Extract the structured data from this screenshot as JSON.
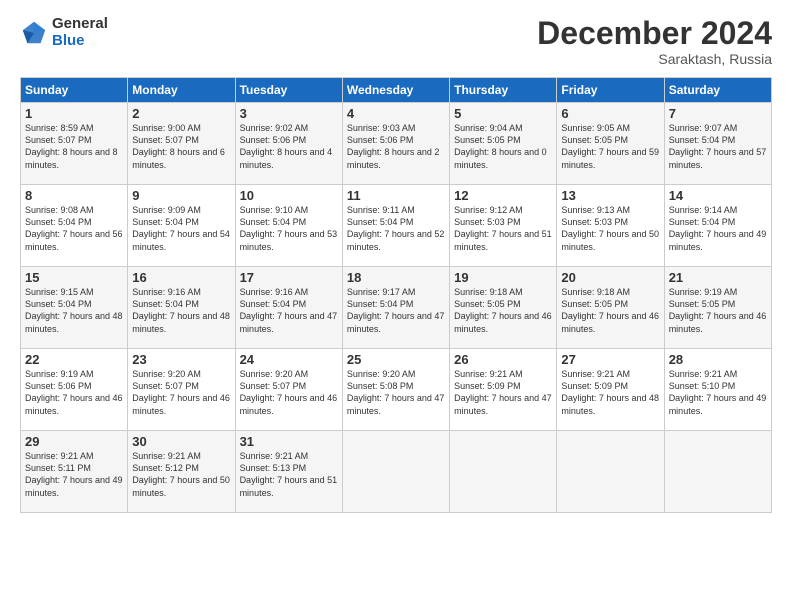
{
  "logo": {
    "general": "General",
    "blue": "Blue"
  },
  "header": {
    "month": "December 2024",
    "location": "Saraktash, Russia"
  },
  "weekdays": [
    "Sunday",
    "Monday",
    "Tuesday",
    "Wednesday",
    "Thursday",
    "Friday",
    "Saturday"
  ],
  "weeks": [
    [
      {
        "day": "1",
        "sunrise": "8:59 AM",
        "sunset": "5:07 PM",
        "daylight": "8 hours and 8 minutes."
      },
      {
        "day": "2",
        "sunrise": "9:00 AM",
        "sunset": "5:07 PM",
        "daylight": "8 hours and 6 minutes."
      },
      {
        "day": "3",
        "sunrise": "9:02 AM",
        "sunset": "5:06 PM",
        "daylight": "8 hours and 4 minutes."
      },
      {
        "day": "4",
        "sunrise": "9:03 AM",
        "sunset": "5:06 PM",
        "daylight": "8 hours and 2 minutes."
      },
      {
        "day": "5",
        "sunrise": "9:04 AM",
        "sunset": "5:05 PM",
        "daylight": "8 hours and 0 minutes."
      },
      {
        "day": "6",
        "sunrise": "9:05 AM",
        "sunset": "5:05 PM",
        "daylight": "7 hours and 59 minutes."
      },
      {
        "day": "7",
        "sunrise": "9:07 AM",
        "sunset": "5:04 PM",
        "daylight": "7 hours and 57 minutes."
      }
    ],
    [
      {
        "day": "8",
        "sunrise": "9:08 AM",
        "sunset": "5:04 PM",
        "daylight": "7 hours and 56 minutes."
      },
      {
        "day": "9",
        "sunrise": "9:09 AM",
        "sunset": "5:04 PM",
        "daylight": "7 hours and 54 minutes."
      },
      {
        "day": "10",
        "sunrise": "9:10 AM",
        "sunset": "5:04 PM",
        "daylight": "7 hours and 53 minutes."
      },
      {
        "day": "11",
        "sunrise": "9:11 AM",
        "sunset": "5:04 PM",
        "daylight": "7 hours and 52 minutes."
      },
      {
        "day": "12",
        "sunrise": "9:12 AM",
        "sunset": "5:03 PM",
        "daylight": "7 hours and 51 minutes."
      },
      {
        "day": "13",
        "sunrise": "9:13 AM",
        "sunset": "5:03 PM",
        "daylight": "7 hours and 50 minutes."
      },
      {
        "day": "14",
        "sunrise": "9:14 AM",
        "sunset": "5:04 PM",
        "daylight": "7 hours and 49 minutes."
      }
    ],
    [
      {
        "day": "15",
        "sunrise": "9:15 AM",
        "sunset": "5:04 PM",
        "daylight": "7 hours and 48 minutes."
      },
      {
        "day": "16",
        "sunrise": "9:16 AM",
        "sunset": "5:04 PM",
        "daylight": "7 hours and 48 minutes."
      },
      {
        "day": "17",
        "sunrise": "9:16 AM",
        "sunset": "5:04 PM",
        "daylight": "7 hours and 47 minutes."
      },
      {
        "day": "18",
        "sunrise": "9:17 AM",
        "sunset": "5:04 PM",
        "daylight": "7 hours and 47 minutes."
      },
      {
        "day": "19",
        "sunrise": "9:18 AM",
        "sunset": "5:05 PM",
        "daylight": "7 hours and 46 minutes."
      },
      {
        "day": "20",
        "sunrise": "9:18 AM",
        "sunset": "5:05 PM",
        "daylight": "7 hours and 46 minutes."
      },
      {
        "day": "21",
        "sunrise": "9:19 AM",
        "sunset": "5:05 PM",
        "daylight": "7 hours and 46 minutes."
      }
    ],
    [
      {
        "day": "22",
        "sunrise": "9:19 AM",
        "sunset": "5:06 PM",
        "daylight": "7 hours and 46 minutes."
      },
      {
        "day": "23",
        "sunrise": "9:20 AM",
        "sunset": "5:07 PM",
        "daylight": "7 hours and 46 minutes."
      },
      {
        "day": "24",
        "sunrise": "9:20 AM",
        "sunset": "5:07 PM",
        "daylight": "7 hours and 46 minutes."
      },
      {
        "day": "25",
        "sunrise": "9:20 AM",
        "sunset": "5:08 PM",
        "daylight": "7 hours and 47 minutes."
      },
      {
        "day": "26",
        "sunrise": "9:21 AM",
        "sunset": "5:09 PM",
        "daylight": "7 hours and 47 minutes."
      },
      {
        "day": "27",
        "sunrise": "9:21 AM",
        "sunset": "5:09 PM",
        "daylight": "7 hours and 48 minutes."
      },
      {
        "day": "28",
        "sunrise": "9:21 AM",
        "sunset": "5:10 PM",
        "daylight": "7 hours and 49 minutes."
      }
    ],
    [
      {
        "day": "29",
        "sunrise": "9:21 AM",
        "sunset": "5:11 PM",
        "daylight": "7 hours and 49 minutes."
      },
      {
        "day": "30",
        "sunrise": "9:21 AM",
        "sunset": "5:12 PM",
        "daylight": "7 hours and 50 minutes."
      },
      {
        "day": "31",
        "sunrise": "9:21 AM",
        "sunset": "5:13 PM",
        "daylight": "7 hours and 51 minutes."
      },
      null,
      null,
      null,
      null
    ]
  ]
}
